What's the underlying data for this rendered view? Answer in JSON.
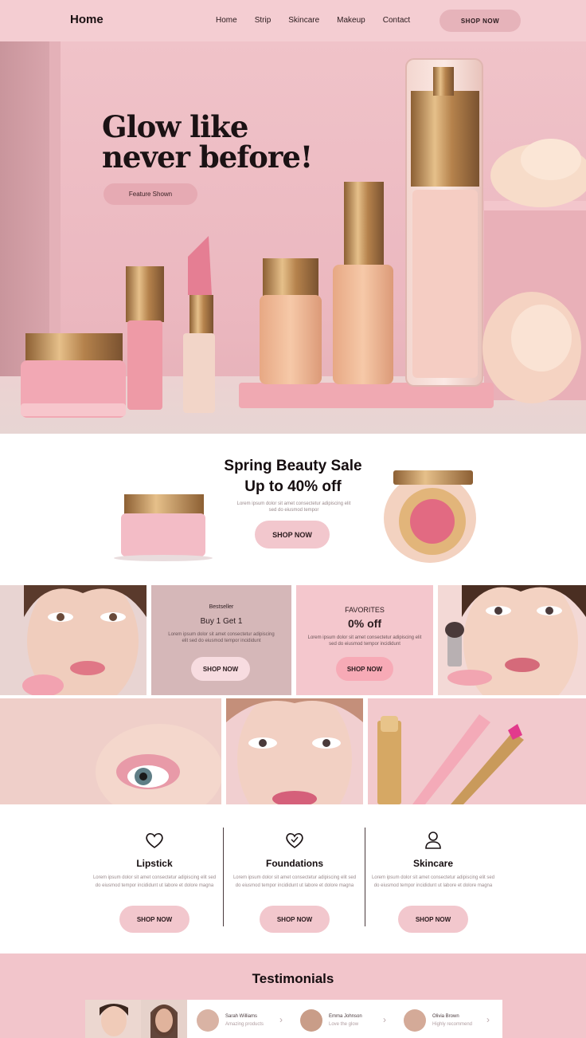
{
  "nav": {
    "logo": "Home",
    "links": [
      "Home",
      "Strip",
      "Skincare",
      "Makeup",
      "Contact"
    ],
    "cta": "SHOP NOW"
  },
  "hero": {
    "headline_line1": "Glow like",
    "headline_line2": "never before!",
    "button": "Feature Shown"
  },
  "promo": {
    "title_line1": "Spring Beauty Sale",
    "title_line2": "Up to 40% off",
    "desc": "Lorem ipsum dolor sit amet consectetur adipiscing elit sed do eiusmod tempor",
    "button": "SHOP NOW"
  },
  "tiles": {
    "tile2": {
      "kicker": "Bestseller",
      "title": "Buy 1 Get 1",
      "desc": "Lorem ipsum dolor sit amet consectetur adipiscing elit sed do eiusmod tempor incididunt",
      "button": "SHOP NOW"
    },
    "tile3": {
      "kicker": "FAVORITES",
      "title": "0% off",
      "desc": "Lorem ipsum dolor sit amet consectetur adipiscing elit sed do eiusmod tempor incididunt",
      "button": "SHOP NOW"
    }
  },
  "categories": [
    {
      "name": "Lipstick",
      "icon": "heart-icon",
      "desc": "Lorem ipsum dolor sit amet consectetur adipiscing elit sed do eiusmod tempor incididunt ut labore et dolore magna",
      "button": "SHOP NOW"
    },
    {
      "name": "Foundations",
      "icon": "heart-check-icon",
      "desc": "Lorem ipsum dolor sit amet consectetur adipiscing elit sed do eiusmod tempor incididunt ut labore et dolore magna",
      "button": "SHOP NOW"
    },
    {
      "name": "Skincare",
      "icon": "user-icon",
      "desc": "Lorem ipsum dolor sit amet consectetur adipiscing elit sed do eiusmod tempor incididunt ut labore et dolore magna",
      "button": "SHOP NOW"
    }
  ],
  "testimonials": {
    "title": "Testimonials",
    "items": [
      {
        "name": "Sarah Williams",
        "line": "Amazing products"
      },
      {
        "name": "Emma Johnson",
        "line": "Love the glow"
      },
      {
        "name": "Olivia Brown",
        "line": "Highly recommend"
      }
    ]
  },
  "colors": {
    "nav_bg": "#f4cdd2",
    "accent_pink": "#f2c7cd",
    "hero_bg": "#ebb7bf",
    "gold": "#c99a5b"
  }
}
